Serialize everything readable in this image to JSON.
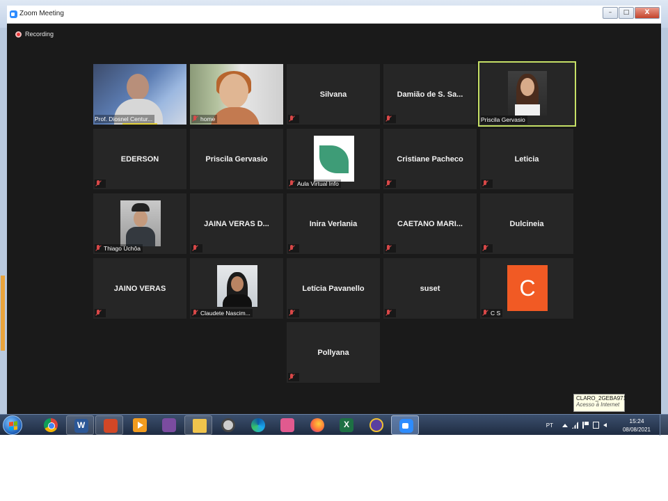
{
  "window": {
    "title": "Zoom Meeting",
    "minimize": "–",
    "restore": "□",
    "close": "X"
  },
  "recording": {
    "label": "Recording",
    "dot_color": "#e8393a"
  },
  "active_speaker_border": "#c6e066",
  "tiles": [
    {
      "name": "Prof. Diosnel Centur...",
      "kind": "video"
    },
    {
      "name": "home",
      "kind": "video"
    },
    {
      "name": "Silvana",
      "kind": "name"
    },
    {
      "name": "Damião de S. Sa...",
      "kind": "name"
    },
    {
      "name": "Priscila Gervasio",
      "kind": "photo"
    },
    {
      "name": "EDERSON",
      "kind": "name"
    },
    {
      "name": "Priscila Gervasio",
      "kind": "name"
    },
    {
      "name": "Aula Virtual Info",
      "kind": "photo"
    },
    {
      "name": "Cristiane Pacheco",
      "kind": "name"
    },
    {
      "name": "Leticia",
      "kind": "name"
    },
    {
      "name": "Thiago Uchôa",
      "kind": "photo"
    },
    {
      "name": "JAINA VERAS D...",
      "kind": "name"
    },
    {
      "name": "Inira Verlania",
      "kind": "name"
    },
    {
      "name": "CAETANO MARI...",
      "kind": "name"
    },
    {
      "name": "Dulcineia",
      "kind": "name"
    },
    {
      "name": "JAINO VERAS",
      "kind": "name"
    },
    {
      "name": "Claudete Nascim...",
      "kind": "photo"
    },
    {
      "name": "Letícia Pavanello",
      "kind": "name"
    },
    {
      "name": "suset",
      "kind": "name"
    },
    {
      "name": "C S",
      "kind": "avatar-letter",
      "letter": "C",
      "color": "#f15a24"
    },
    {
      "name": "Pollyana",
      "kind": "name"
    }
  ],
  "tooltip": {
    "line1": "CLARO_2GEBA971",
    "line2": "Acesso à Internet"
  },
  "taskbar": {
    "apps": [
      "start-icon",
      "chrome-icon",
      "word-icon",
      "powerpoint-icon",
      "video-player-icon",
      "onenote-icon",
      "file-explorer-icon",
      "media-player-icon",
      "edge-icon",
      "paint-icon",
      "firefox-icon",
      "excel-icon",
      "security-icon",
      "zoom-icon"
    ],
    "language": "PT",
    "time": "15:24",
    "date": "08/08/2021"
  }
}
